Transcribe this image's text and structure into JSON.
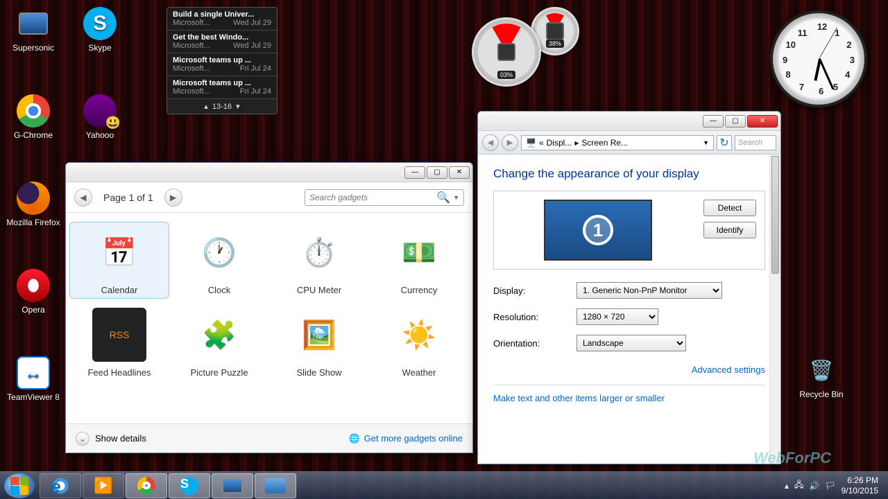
{
  "desktop_icons": {
    "supersonic": "Supersonic",
    "skype": "Skype",
    "gchrome": "G-Chrome",
    "yahoo": "Yahooo",
    "firefox": "Mozilla Firefox",
    "opera": "Opera",
    "teamviewer": "TeamViewer 8",
    "recycle": "Recycle Bin"
  },
  "feed": {
    "items": [
      {
        "title": "Build a single Univer...",
        "source": "Microsoft...",
        "date": "Wed Jul 29"
      },
      {
        "title": "Get the best Windo...",
        "source": "Microsoft...",
        "date": "Wed Jul 29"
      },
      {
        "title": "Microsoft teams up ...",
        "source": "Microsoft...",
        "date": "Fri Jul 24"
      },
      {
        "title": "Microsoft teams up ...",
        "source": "Microsoft...",
        "date": "Fri Jul 24"
      }
    ],
    "pager": "13-16"
  },
  "gauges": {
    "cpu": "03%",
    "ram": "38%"
  },
  "gadgets": {
    "page_label": "Page 1 of 1",
    "search_placeholder": "Search gadgets",
    "items": [
      "Calendar",
      "Clock",
      "CPU Meter",
      "Currency",
      "Feed Headlines",
      "Picture Puzzle",
      "Slide Show",
      "Weather"
    ],
    "show_details": "Show details",
    "more_link": "Get more gadgets online"
  },
  "display": {
    "crumb1": "Displ...",
    "crumb2": "Screen Re...",
    "search_placeholder": "Search",
    "heading": "Change the appearance of your display",
    "detect": "Detect",
    "identify": "Identify",
    "monitor_num": "1",
    "label_display": "Display:",
    "value_display": "1. Generic Non-PnP Monitor",
    "label_resolution": "Resolution:",
    "value_resolution": "1280 × 720",
    "label_orientation": "Orientation:",
    "value_orientation": "Landscape",
    "advanced": "Advanced settings",
    "larger": "Make text and other items larger or smaller"
  },
  "taskbar": {
    "time": "6:26 PM",
    "date": "9/10/2015"
  },
  "watermark": "WebForPC"
}
